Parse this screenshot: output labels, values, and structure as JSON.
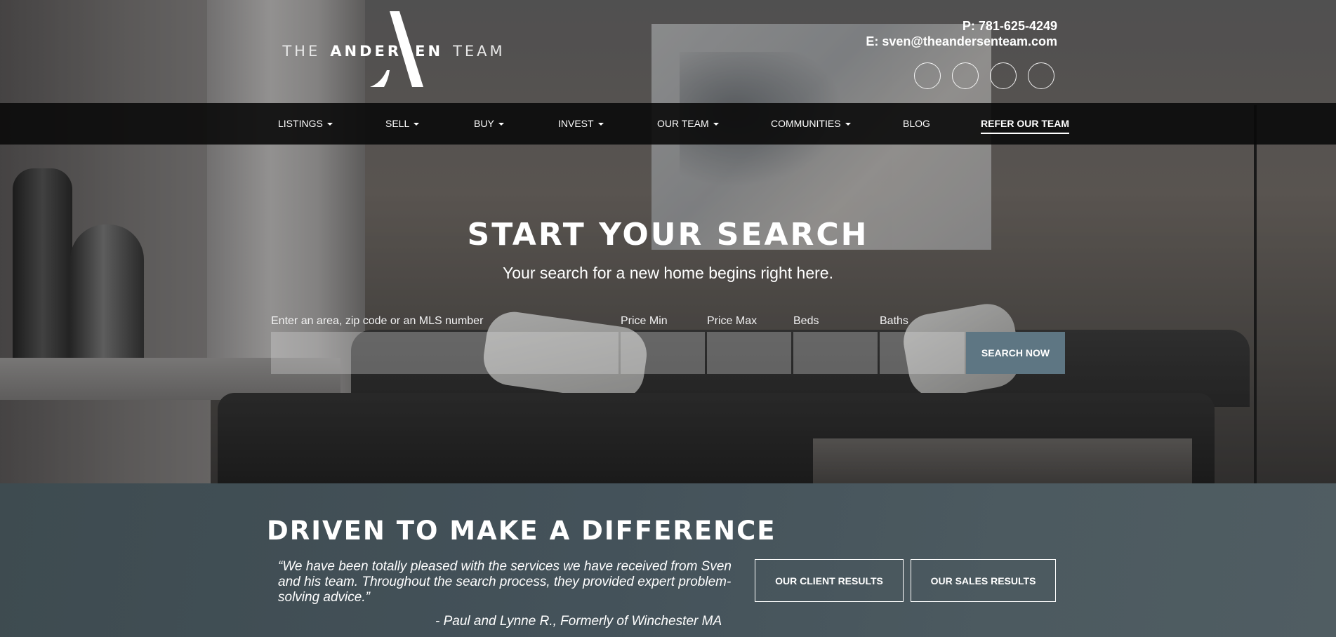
{
  "brand": {
    "the": "THE",
    "name": "ANDERSEN",
    "team": "TEAM"
  },
  "contact": {
    "phone": "P: 781-625-4249",
    "email": "E: sven@theandersenteam.com"
  },
  "nav": {
    "items": [
      {
        "label": "LISTINGS",
        "dropdown": true
      },
      {
        "label": "SELL",
        "dropdown": true
      },
      {
        "label": "BUY",
        "dropdown": true
      },
      {
        "label": "INVEST",
        "dropdown": true
      },
      {
        "label": "OUR TEAM",
        "dropdown": true
      },
      {
        "label": "COMMUNITIES",
        "dropdown": true
      },
      {
        "label": "BLOG",
        "dropdown": false
      },
      {
        "label": "REFER OUR TEAM",
        "dropdown": false,
        "active": true
      }
    ]
  },
  "hero": {
    "title": "START YOUR SEARCH",
    "subtitle": "Your search for a new home begins right here."
  },
  "search": {
    "labels": {
      "area": "Enter an area, zip code or an MLS number",
      "price_min": "Price Min",
      "price_max": "Price Max",
      "beds": "Beds",
      "baths": "Baths"
    },
    "button": "SEARCH NOW"
  },
  "section": {
    "title": "DRIVEN TO MAKE A DIFFERENCE",
    "quote": "“We have been totally pleased with the services we have received from Sven and his team. Throughout the search process, they provided expert problem-solving advice.”",
    "attribution": "- Paul and Lynne R., Formerly of Winchester MA",
    "buttons": {
      "client": "OUR CLIENT RESULTS",
      "sales": "OUR SALES RESULTS"
    }
  },
  "colors": {
    "accent": "#5e7683",
    "band": "#44525a",
    "nav": "#0a0a0a"
  },
  "icons": [
    "social-icon-1",
    "social-icon-2",
    "social-icon-3",
    "social-icon-4"
  ]
}
